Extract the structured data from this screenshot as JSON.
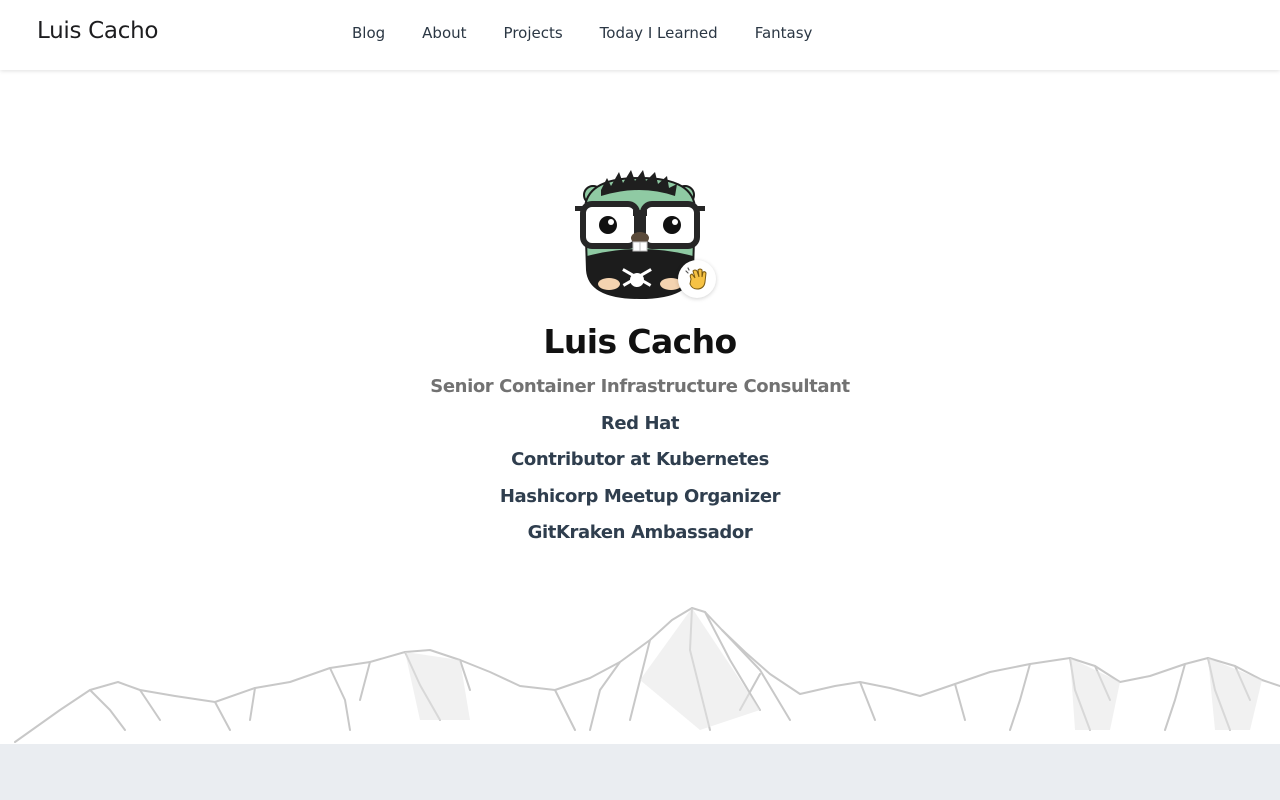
{
  "site": {
    "brand": "Luis Cacho"
  },
  "nav": {
    "items": [
      {
        "label": "Blog"
      },
      {
        "label": "About"
      },
      {
        "label": "Projects"
      },
      {
        "label": "Today I Learned"
      },
      {
        "label": "Fantasy"
      }
    ]
  },
  "profile": {
    "name": "Luis Cacho",
    "role": "Senior Container Infrastructure Consultant",
    "affiliations": [
      "Red Hat",
      "Contributor at Kubernetes",
      "Hashicorp Meetup Organizer",
      "GitKraken Ambassador"
    ],
    "avatar": "gopher-with-glasses-avatar",
    "badge_icon": "waving-hand-icon"
  },
  "colors": {
    "accent_text": "#2f3e4e",
    "muted_text": "#727272",
    "footer_band": "#eaedf1"
  }
}
